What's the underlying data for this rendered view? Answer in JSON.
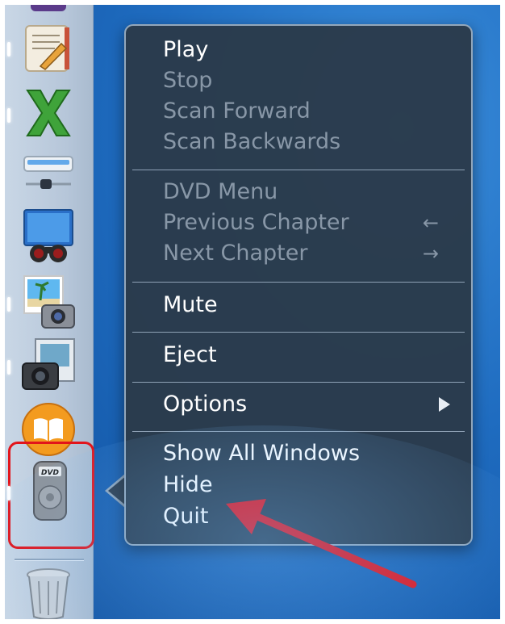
{
  "context_menu": {
    "group1": [
      {
        "label": "Play",
        "enabled": true
      },
      {
        "label": "Stop",
        "enabled": false
      },
      {
        "label": "Scan Forward",
        "enabled": false
      },
      {
        "label": "Scan Backwards",
        "enabled": false
      }
    ],
    "group2": [
      {
        "label": "DVD Menu",
        "enabled": false
      },
      {
        "label": "Previous Chapter",
        "enabled": false,
        "shortcut": "←"
      },
      {
        "label": "Next Chapter",
        "enabled": false,
        "shortcut": "→"
      }
    ],
    "group3": [
      {
        "label": "Mute",
        "enabled": true
      }
    ],
    "group4": [
      {
        "label": "Eject",
        "enabled": true
      }
    ],
    "group5": [
      {
        "label": "Options",
        "enabled": true
      }
    ],
    "group6": [
      {
        "label": "Show All Windows",
        "enabled": true
      },
      {
        "label": "Hide",
        "enabled": true
      },
      {
        "label": "Quit",
        "enabled": true
      }
    ]
  },
  "dock": {
    "items": [
      "iBooks Author",
      "Microsoft Excel",
      "Drive Utility",
      "Preview",
      "iPhoto",
      "Image Capture",
      "iBooks",
      "DVD Player",
      "Trash"
    ],
    "dvd_icon_text": "DVD",
    "selected": "DVD Player"
  },
  "colors": {
    "highlight": "#e2141b",
    "menu_bg": "#2b3a4a",
    "desktop": "#1f6cc0"
  }
}
